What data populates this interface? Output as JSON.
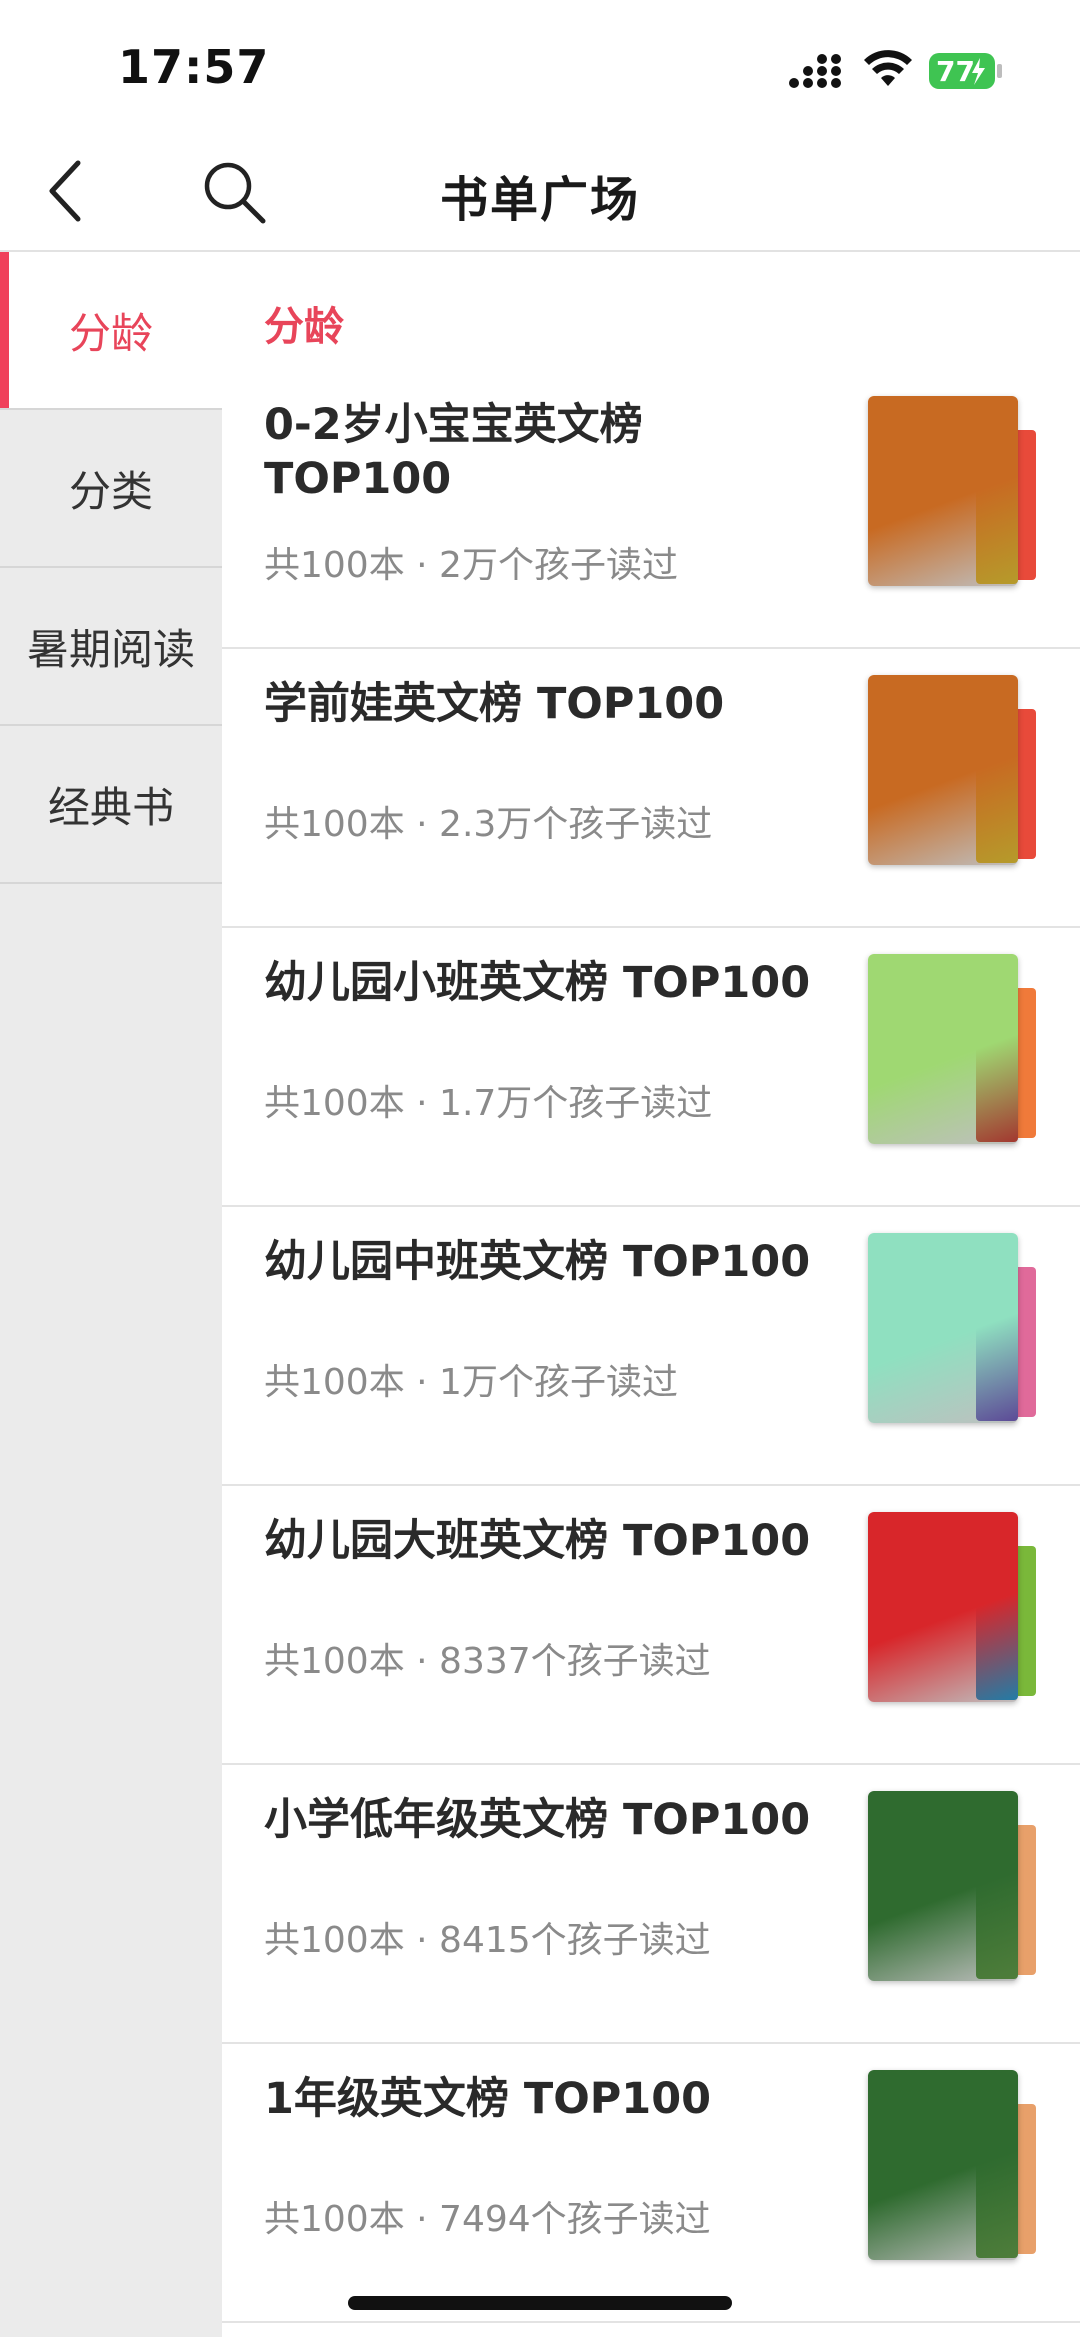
{
  "status_bar": {
    "time": "17:57",
    "battery_level": "77",
    "battery_color": "#3fc452"
  },
  "nav": {
    "title": "书单广场",
    "back_icon": "chevron-left-icon",
    "search_icon": "search-icon"
  },
  "sidebar": {
    "items": [
      {
        "label": "分龄",
        "active": true
      },
      {
        "label": "分类",
        "active": false
      },
      {
        "label": "暑期阅读",
        "active": false
      },
      {
        "label": "经典书",
        "active": false
      }
    ]
  },
  "accent_color": "#e8455a",
  "section": {
    "title": "分龄"
  },
  "books": [
    {
      "title": "0-2岁小宝宝英文榜 TOP100",
      "meta": "共100本 · 2万个孩子读过",
      "cover_colors": [
        "#c86a22",
        "#f2d03a",
        "#e84a3a"
      ]
    },
    {
      "title": "学前娃英文榜 TOP100",
      "meta": "共100本 · 2.3万个孩子读过",
      "cover_colors": [
        "#c86a22",
        "#f2d03a",
        "#e84a3a"
      ]
    },
    {
      "title": "幼儿园小班英文榜 TOP100",
      "meta": "共100本 · 1.7万个孩子读过",
      "cover_colors": [
        "#9fd872",
        "#d9463e",
        "#f07a3a"
      ]
    },
    {
      "title": "幼儿园中班英文榜 TOP100",
      "meta": "共100本 · 1万个孩子读过",
      "cover_colors": [
        "#8fe0c0",
        "#7a5fc8",
        "#e06a9a"
      ]
    },
    {
      "title": "幼儿园大班英文榜 TOP100",
      "meta": "共100本 · 8337个孩子读过",
      "cover_colors": [
        "#d8262a",
        "#2aa7e0",
        "#7ab83a"
      ]
    },
    {
      "title": "小学低年级英文榜 TOP100",
      "meta": "共100本 · 8415个孩子读过",
      "cover_colors": [
        "#2f6b2f",
        "#6aa84f",
        "#e8a06a"
      ]
    },
    {
      "title": "1年级英文榜 TOP100",
      "meta": "共100本 · 7494个孩子读过",
      "cover_colors": [
        "#2f6b2f",
        "#6aa84f",
        "#e8a06a"
      ]
    }
  ]
}
